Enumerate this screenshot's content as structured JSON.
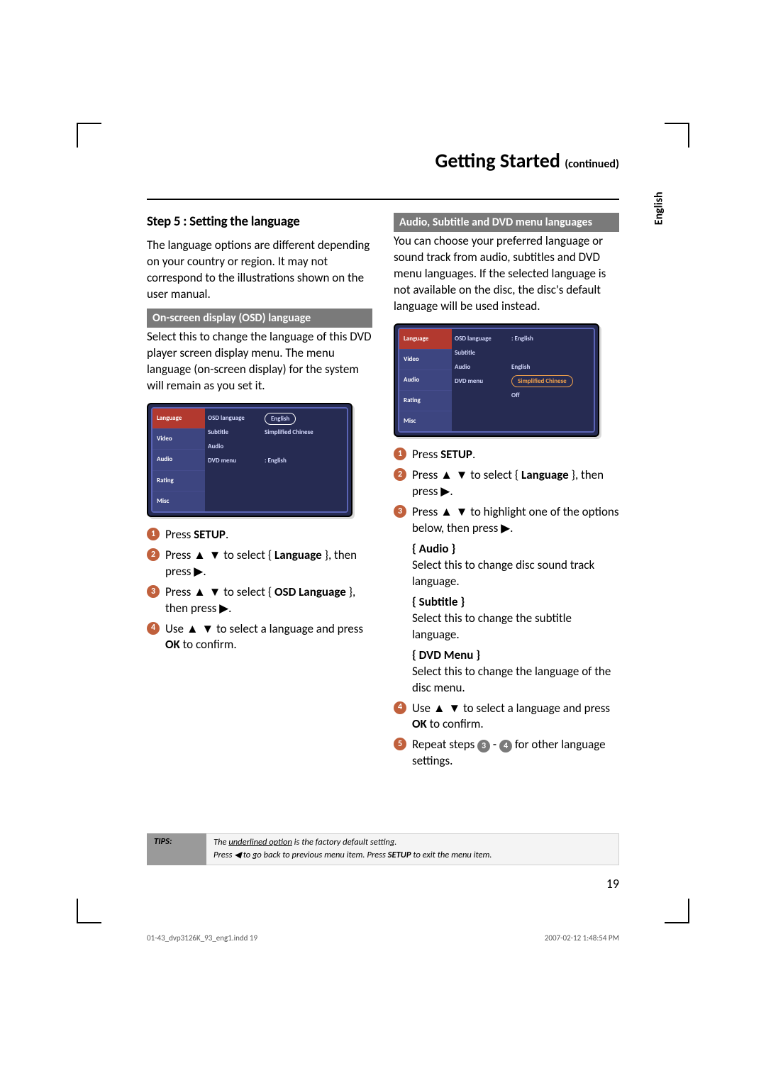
{
  "pageTitle": "Getting Started",
  "pageTitleCont": "(continued)",
  "sideTab": "English",
  "pageNumber": "19",
  "left": {
    "stepHeading": "Step 5 : Setting the language",
    "intro": "The language options are different depending on your country or region. It may not correspond to the illustrations shown on the user manual.",
    "osdHeader": "On-screen display (OSD) language",
    "osdBody": "Select this to change the language of this DVD player screen display menu. The menu language (on-screen display) for the system will remain as you set it.",
    "shot": {
      "side": [
        "Language",
        "Video",
        "Audio",
        "Rating",
        "Misc"
      ],
      "rows": [
        {
          "label": "OSD language",
          "val": "English",
          "tag": "white"
        },
        {
          "label": "Subtitle",
          "val": "Simplified Chinese"
        },
        {
          "label": "Audio",
          "val": ""
        },
        {
          "label": "DVD menu",
          "val": ": English"
        }
      ]
    },
    "steps": [
      {
        "n": "1",
        "text": "Press <b>SETUP</b>."
      },
      {
        "n": "2",
        "text": "Press <span class='tri'>▲ ▼</span> to select { <b>Language</b> }, then press <span class='tri'>▶</span>."
      },
      {
        "n": "3",
        "text": "Press <span class='tri'>▲ ▼</span> to select { <b>OSD Language</b> }, then press <span class='tri'>▶</span>."
      },
      {
        "n": "4",
        "text": "Use <span class='tri'>▲ ▼</span> to select a language and press <b>OK</b> to confirm."
      }
    ]
  },
  "right": {
    "audioHeader": "Audio, Subtitle and DVD menu languages",
    "intro": "You can choose your preferred language or sound track from audio, subtitles and DVD menu languages. If the selected language is not available on the disc, the disc's default language will be used instead.",
    "shot": {
      "side": [
        "Language",
        "Video",
        "Audio",
        "Rating",
        "Misc"
      ],
      "rows": [
        {
          "label": "OSD language",
          "val": ": English"
        },
        {
          "label": "Subtitle",
          "val": ""
        },
        {
          "label": "Audio",
          "val": "English"
        },
        {
          "label": "DVD menu",
          "val": "Simplified Chinese",
          "tag": "orange"
        },
        {
          "label": "",
          "val": "Off"
        }
      ]
    },
    "steps1": [
      {
        "n": "1",
        "text": "Press <b>SETUP</b>."
      },
      {
        "n": "2",
        "text": "Press <span class='tri'>▲ ▼</span> to select { <b>Language</b> }, then press <span class='tri'>▶</span>."
      },
      {
        "n": "3",
        "text": "Press <span class='tri'>▲ ▼</span> to highlight one of the options below, then press <span class='tri'>▶</span>."
      }
    ],
    "options": [
      {
        "name": "{ Audio }",
        "desc": "Select this to change disc sound track language."
      },
      {
        "name": "{ Subtitle }",
        "desc": "Select this to change the subtitle language."
      },
      {
        "name": "{ DVD Menu }",
        "desc": "Select this to change the language of the disc menu."
      }
    ],
    "steps2": [
      {
        "n": "4",
        "text": "Use <span class='tri'>▲ ▼</span> to select a language and press <b>OK</b> to confirm."
      },
      {
        "n": "5",
        "text": "Repeat steps <span class='bullet grey'>3</span> - <span class='bullet grey'>4</span> for other language settings."
      }
    ]
  },
  "tips": {
    "label": "TIPS:",
    "line1": "The <span class='u'>underlined option</span> is the factory default setting.",
    "line2": "Press <span class='tri'>◀</span> to go back to previous menu item. Press <b>SETUP</b> to exit the menu item."
  },
  "footer": {
    "left": "01-43_dvp3126K_93_eng1.indd   19",
    "right": "2007-02-12   1:48:54 PM"
  }
}
